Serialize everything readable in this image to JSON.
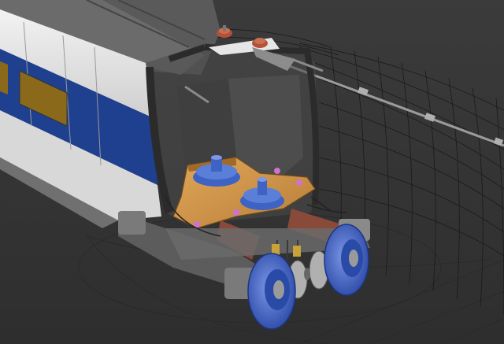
{
  "scene": {
    "subject": "train-car-bogie-cutaway",
    "colors": {
      "background": "#3b3b3b",
      "background_dark": "#2e2e2e",
      "body_white": "#e8e8e8",
      "body_shade": "#bdbdbd",
      "stripe_blue": "#1f3f8f",
      "window_gold": "#8a6a1a",
      "wireframe": "#1a1a1a",
      "plate_orange": "#d49a4a",
      "gear_blue": "#3f63c4",
      "wheel_blue": "#4a6fd6",
      "axle_grey": "#9a9a9a",
      "strap_red": "#8a4a3a",
      "spring_red": "#b5503a",
      "marker_pink": "#d070d0"
    },
    "icons": [
      "bogie-frame",
      "wheelset",
      "pivot-gear",
      "pantograph-insulator",
      "roof-rail"
    ]
  }
}
